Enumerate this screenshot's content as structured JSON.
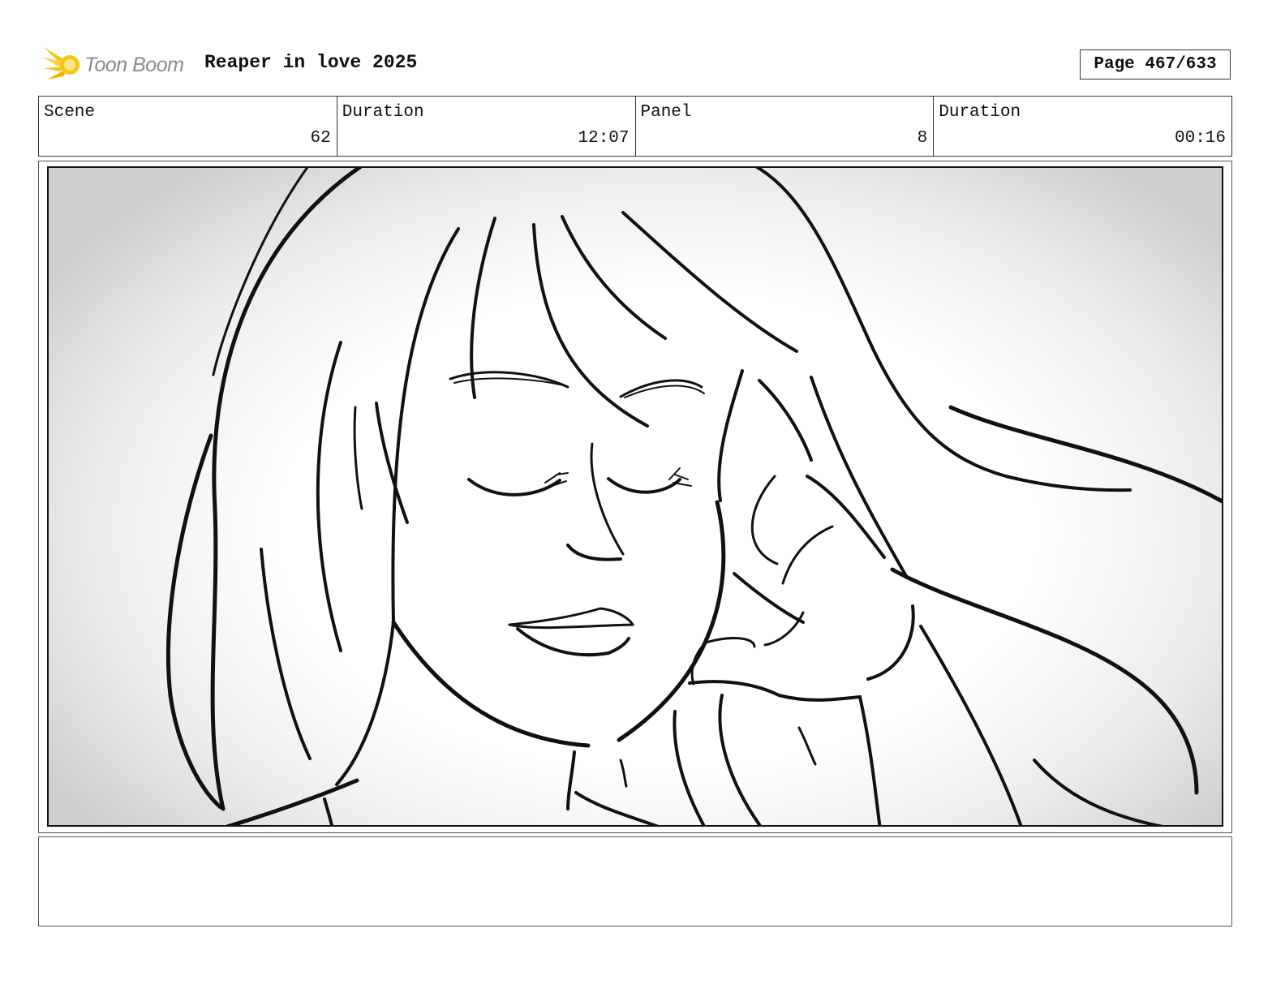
{
  "header": {
    "logo_text": "Toon Boom",
    "project_title": "Reaper in love 2025",
    "page_indicator": "Page 467/633"
  },
  "info": {
    "scene_label": "Scene",
    "scene_value": "62",
    "scene_duration_label": "Duration",
    "scene_duration_value": "12:07",
    "panel_label": "Panel",
    "panel_value": "8",
    "panel_duration_label": "Duration",
    "panel_duration_value": "00:16"
  },
  "panel": {
    "icon": "sketch-drawing",
    "stroke_color": "#111111",
    "vignette_color": "#cfcfcf"
  },
  "notes": {
    "text": ""
  },
  "colors": {
    "logo_flame": "#f5c518",
    "logo_text": "#8a8a8a"
  }
}
